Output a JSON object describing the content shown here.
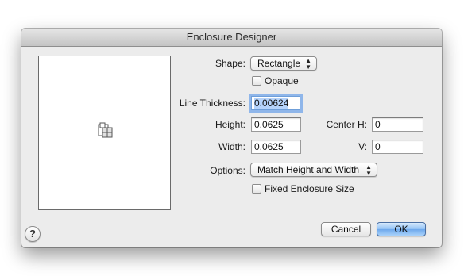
{
  "window": {
    "title": "Enclosure Designer"
  },
  "preview": {
    "icon": "enclosure-shape-icon"
  },
  "shape": {
    "label": "Shape:",
    "value": "Rectangle"
  },
  "opaque": {
    "label": "Opaque",
    "checked": false
  },
  "line_thickness": {
    "label": "Line Thickness:",
    "value": "0.00624"
  },
  "height": {
    "label": "Height:",
    "value": "0.0625"
  },
  "width": {
    "label": "Width:",
    "value": "0.0625"
  },
  "center_h": {
    "label": "Center H:",
    "value": "0"
  },
  "center_v": {
    "label": "V:",
    "value": "0"
  },
  "options": {
    "label": "Options:",
    "value": "Match Height and Width"
  },
  "fixed_size": {
    "label": "Fixed Enclosure Size",
    "checked": false
  },
  "buttons": {
    "cancel": "Cancel",
    "ok": "OK",
    "help": "?"
  },
  "colors": {
    "default_button": "#8fc0f5",
    "focus_ring": "#8fb6ea"
  }
}
